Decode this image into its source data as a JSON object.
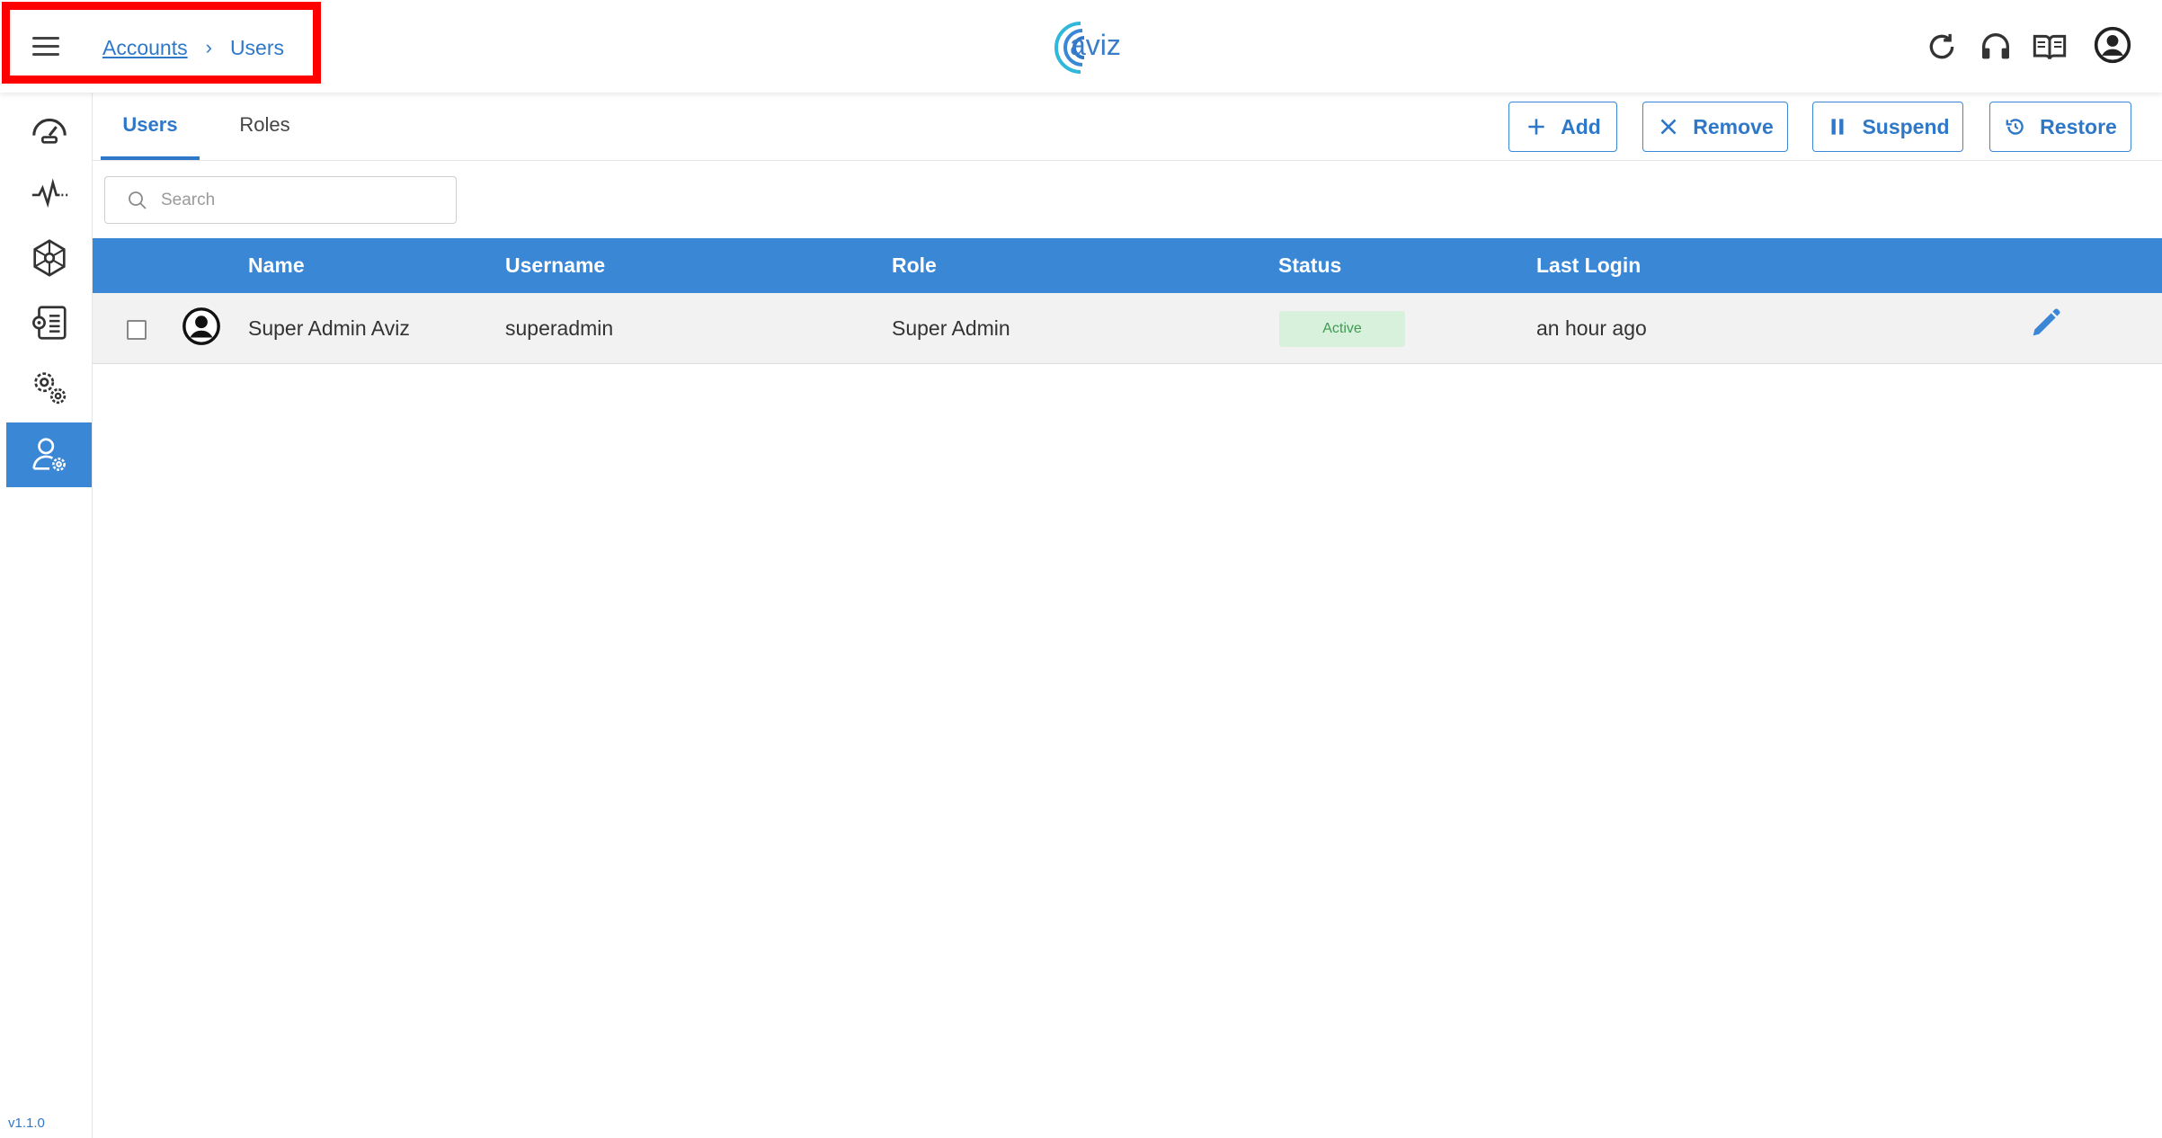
{
  "breadcrumb": {
    "parent": "Accounts",
    "separator": "›",
    "current": "Users"
  },
  "logo": {
    "text": "aviz"
  },
  "header_icons": [
    "refresh-icon",
    "headset-icon",
    "book-icon",
    "account-circle-icon"
  ],
  "sidebar": {
    "items": [
      {
        "name": "dashboard-gauge-icon",
        "active": false
      },
      {
        "name": "pulse-icon",
        "active": false
      },
      {
        "name": "network-hexagon-icon",
        "active": false
      },
      {
        "name": "document-settings-icon",
        "active": false
      },
      {
        "name": "gears-icon",
        "active": false
      },
      {
        "name": "user-settings-icon",
        "active": true
      }
    ],
    "version": "v1.1.0"
  },
  "tabs": [
    {
      "label": "Users",
      "active": true
    },
    {
      "label": "Roles",
      "active": false
    }
  ],
  "actions": {
    "add": "Add",
    "remove": "Remove",
    "suspend": "Suspend",
    "restore": "Restore"
  },
  "search": {
    "placeholder": "Search"
  },
  "table": {
    "columns": {
      "name": "Name",
      "username": "Username",
      "role": "Role",
      "status": "Status",
      "last_login": "Last Login"
    },
    "rows": [
      {
        "name": "Super Admin Aviz",
        "username": "superadmin",
        "role": "Super Admin",
        "status": "Active",
        "last_login": "an hour ago"
      }
    ]
  },
  "colors": {
    "accent": "#3a87d6",
    "link": "#2f78c8",
    "highlight_box": "#ff0000",
    "status_active_bg": "#d8f1dc",
    "status_active_text": "#3f9b51"
  }
}
